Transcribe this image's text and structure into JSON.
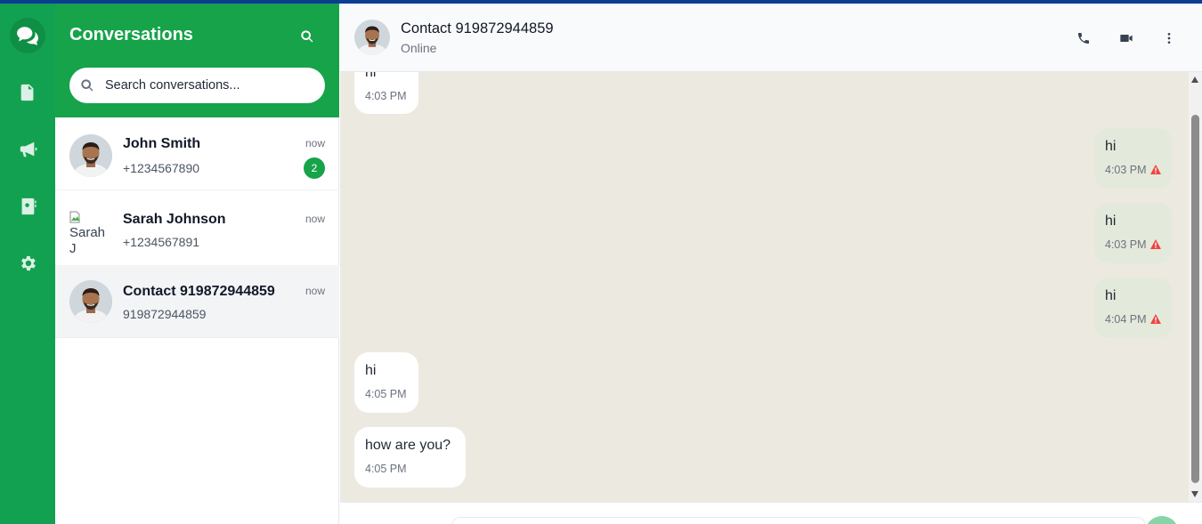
{
  "sidebar_rail": {
    "items": [
      {
        "icon": "chat-bubbles-icon",
        "active": true
      },
      {
        "icon": "document-icon",
        "active": false
      },
      {
        "icon": "megaphone-icon",
        "active": false
      },
      {
        "icon": "contact-book-icon",
        "active": false
      },
      {
        "icon": "gear-icon",
        "active": false
      }
    ]
  },
  "conversations": {
    "title": "Conversations",
    "search_placeholder": "Search conversations...",
    "items": [
      {
        "name": "John Smith",
        "subtitle": "+1234567890",
        "time": "now",
        "unread": "2",
        "avatar": "photo"
      },
      {
        "name": "Sarah Johnson",
        "subtitle": "+1234567891",
        "time": "now",
        "avatar_alt": "Sarah J",
        "avatar": "broken"
      },
      {
        "name": "Contact 919872944859",
        "subtitle": "919872944859",
        "time": "now",
        "avatar": "photo",
        "selected": true
      }
    ]
  },
  "chat": {
    "contact_name": "Contact 919872944859",
    "status": "Online",
    "actions": [
      "phone-icon",
      "video-icon",
      "more-vertical-icon"
    ],
    "messages": [
      {
        "direction": "in",
        "text": "hi",
        "time": "4:03 PM"
      },
      {
        "direction": "out",
        "text": "hi",
        "time": "4:03 PM",
        "failed": true
      },
      {
        "direction": "out",
        "text": "hi",
        "time": "4:03 PM",
        "failed": true
      },
      {
        "direction": "out",
        "text": "hi",
        "time": "4:04 PM",
        "failed": true
      },
      {
        "direction": "in",
        "text": "hi",
        "time": "4:05 PM"
      },
      {
        "direction": "in",
        "text": "how are you?",
        "time": "4:05 PM"
      }
    ]
  },
  "colors": {
    "brand_green": "#16a34a",
    "rail_green": "#12a150",
    "chat_background": "#ece9e1",
    "outgoing_bubble": "#e4eadb",
    "warning_red": "#ef4444"
  }
}
